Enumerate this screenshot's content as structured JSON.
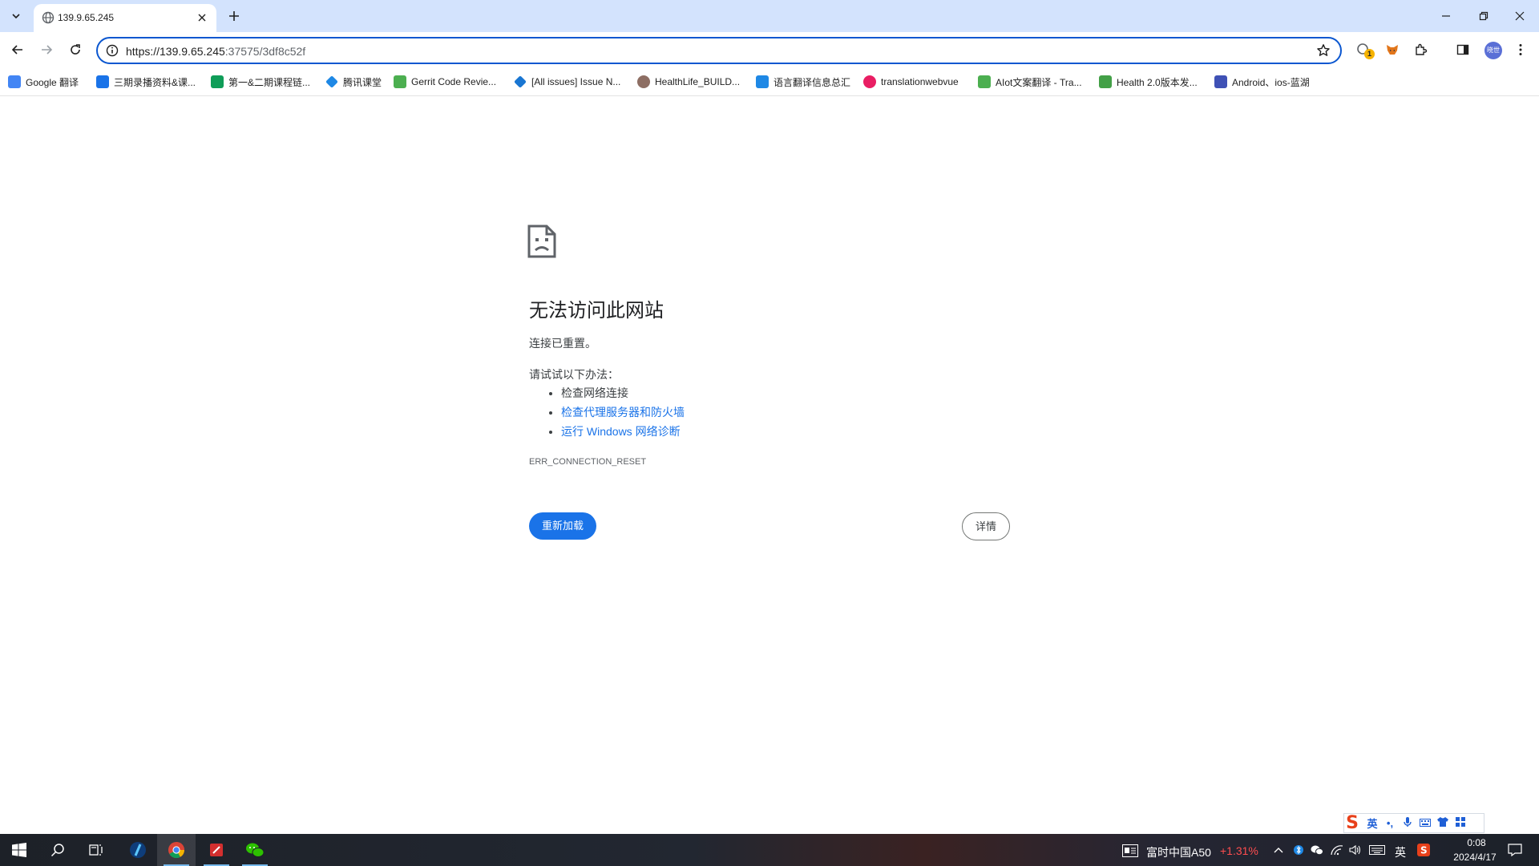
{
  "browser": {
    "tab": {
      "title": "139.9.65.245"
    },
    "omnibox": {
      "url_host": "https://139.9.65.245",
      "url_rest": ":37575/3df8c52f"
    },
    "extensions_badge": "1",
    "profile_initials": "晓世"
  },
  "bookmarks": [
    {
      "label": "Google 翻译",
      "color": "#4285f4"
    },
    {
      "label": "三期录播资料&课...",
      "color": "#1a73e8"
    },
    {
      "label": "第一&二期课程链...",
      "color": "#0f9d58"
    },
    {
      "label": "腾讯课堂",
      "color": "#1e88e5"
    },
    {
      "label": "Gerrit Code Revie...",
      "color": "#4caf50"
    },
    {
      "label": "[All issues] Issue N...",
      "color": "#1976d2"
    },
    {
      "label": "HealthLife_BUILD...",
      "color": "#8d6e63"
    },
    {
      "label": "语言翻译信息总汇",
      "color": "#1e88e5"
    },
    {
      "label": "translationwebvue",
      "color": "#e91e63"
    },
    {
      "label": "AIot文案翻译 - Tra...",
      "color": "#4caf50"
    },
    {
      "label": "Health 2.0版本发...",
      "color": "#43a047"
    },
    {
      "label": "Android、ios-蓝湖",
      "color": "#3f51b5"
    }
  ],
  "error_page": {
    "title": "无法访问此网站",
    "subtitle": "连接已重置。",
    "try_heading": "请试试以下办法：",
    "suggestions": [
      "检查网络连接",
      "检查代理服务器和防火墙",
      "运行 Windows 网络诊断"
    ],
    "error_code": "ERR_CONNECTION_RESET",
    "reload_label": "重新加载",
    "details_label": "详情"
  },
  "ime": {
    "mode": "英",
    "punct": "•,"
  },
  "taskbar": {
    "stock_name": "富时中国A50",
    "stock_change": "+1.31%",
    "ime_indicator": "英",
    "time": "0:08",
    "date": "2024/4/17"
  }
}
